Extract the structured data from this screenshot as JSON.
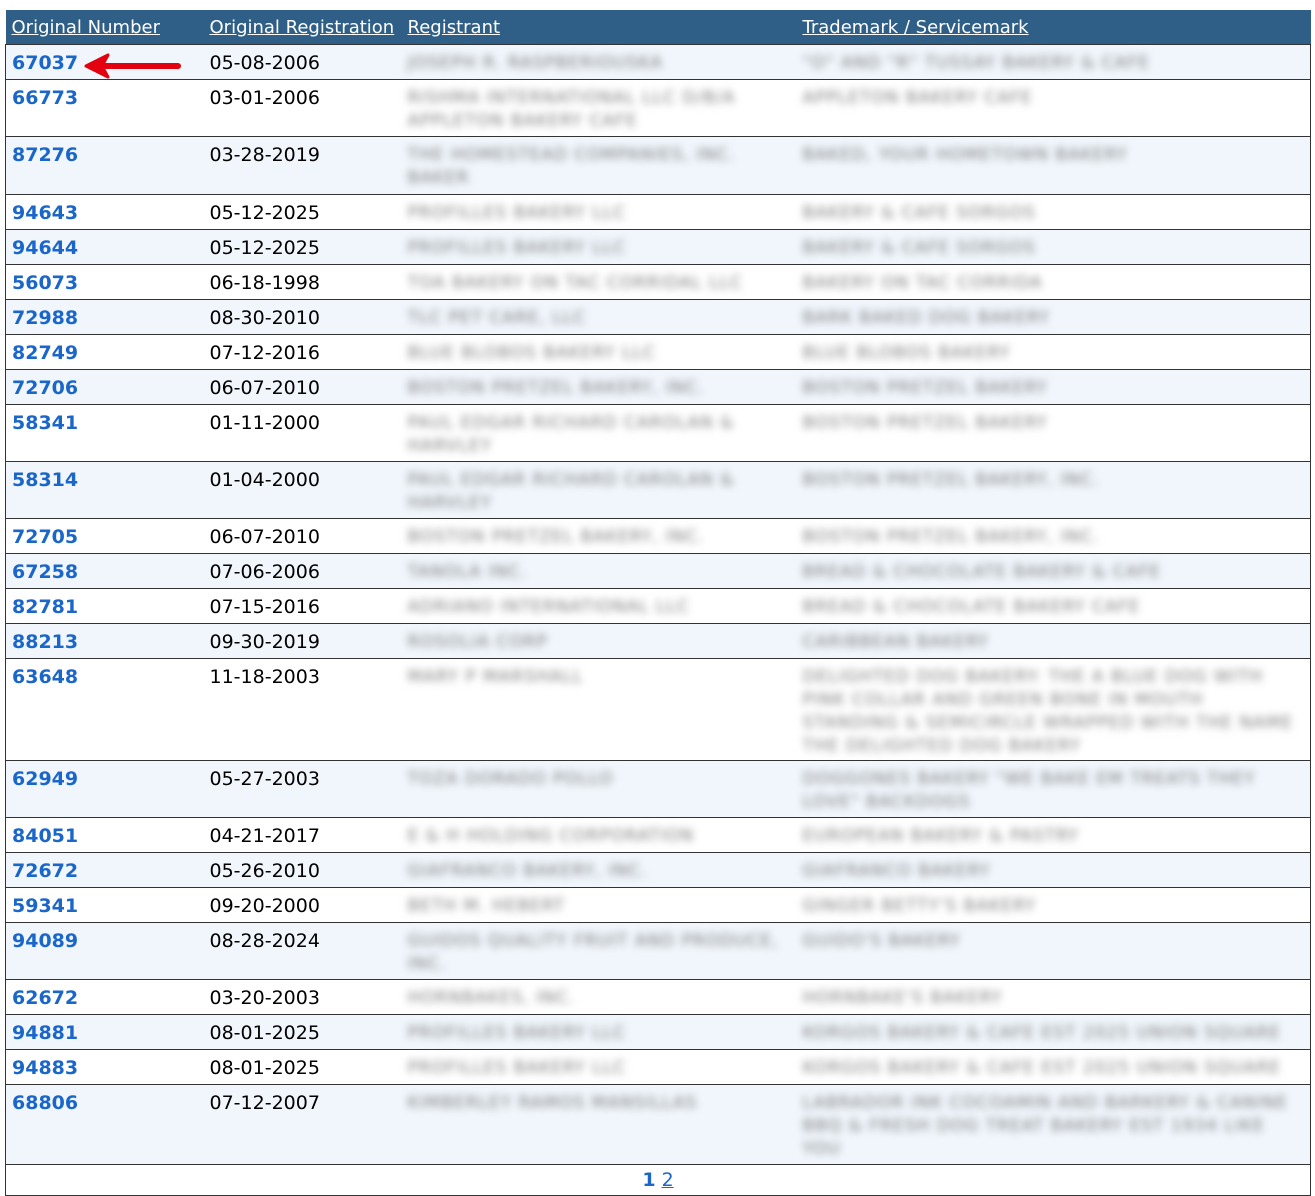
{
  "headers": [
    "Original Number",
    "Original Registration",
    "Registrant",
    "Trademark / Servicemark"
  ],
  "rows": [
    {
      "number": "67037",
      "date": "05-08-2006",
      "registrant": "JOSEPH R. RASPBERIOUSKA",
      "mark": "\"O\" AND \"R\" TUSSAY BAKERY & CAFE"
    },
    {
      "number": "66773",
      "date": "03-01-2006",
      "registrant": "RISHMA INTERNATIONAL LLC D/B/A APPLETON BAKERY CAFE",
      "mark": "APPLETON BAKERY CAFE"
    },
    {
      "number": "87276",
      "date": "03-28-2019",
      "registrant": "THE HOMESTEAD COMPANIES, INC. BAKER",
      "mark": "BAKED, YOUR HOMETOWN BAKERY"
    },
    {
      "number": "94643",
      "date": "05-12-2025",
      "registrant": "PROFILLES BAKERY LLC",
      "mark": "BAKERY & CAFE SORGOS"
    },
    {
      "number": "94644",
      "date": "05-12-2025",
      "registrant": "PROFILLES BAKERY LLC",
      "mark": "BAKERY & CAFE SORGOS"
    },
    {
      "number": "56073",
      "date": "06-18-1998",
      "registrant": "TOA BAKERY ON TAC CORRIDAL LLC",
      "mark": "BAKERY ON TAC CORRIDA"
    },
    {
      "number": "72988",
      "date": "08-30-2010",
      "registrant": "TLC PET CARE, LLC",
      "mark": "BARK BAKED DOG BAKERY"
    },
    {
      "number": "82749",
      "date": "07-12-2016",
      "registrant": "BLUE BLOBOS BAKERY LLC",
      "mark": "BLUE BLOBOS BAKERY"
    },
    {
      "number": "72706",
      "date": "06-07-2010",
      "registrant": "BOSTON PRETZEL BAKERY, INC.",
      "mark": "BOSTON PRETZEL BAKERY"
    },
    {
      "number": "58341",
      "date": "01-11-2000",
      "registrant": "PAUL EDGAR RICHARD CAROLAN & HARVLEY",
      "mark": "BOSTON PRETZEL BAKERY"
    },
    {
      "number": "58314",
      "date": "01-04-2000",
      "registrant": "PAUL EDGAR RICHARD CAROLAN & HARVLEY",
      "mark": "BOSTON PRETZEL BAKERY, INC."
    },
    {
      "number": "72705",
      "date": "06-07-2010",
      "registrant": "BOSTON PRETZEL BAKERY, INC.",
      "mark": "BOSTON PRETZEL BAKERY, INC."
    },
    {
      "number": "67258",
      "date": "07-06-2006",
      "registrant": "TANOLA INC.",
      "mark": "BREAD & CHOCOLATE BAKERY & CAFE"
    },
    {
      "number": "82781",
      "date": "07-15-2016",
      "registrant": "ADRIANO INTERNATIONAL LLC",
      "mark": "BREAD & CHOCOLATE BAKERY CAFE"
    },
    {
      "number": "88213",
      "date": "09-30-2019",
      "registrant": "ROSOLIA CORP",
      "mark": "CARIBBEAN BAKERY"
    },
    {
      "number": "63648",
      "date": "11-18-2003",
      "registrant": "MARY P MARSHALL",
      "mark": "DELIGHTED DOG BAKERY: THE A BLUE DOG WITH PINK COLLAR AND GREEN BONE IN MOUTH STANDING & SEMICIRCLE WRAPPED WITH THE NAME THE DELIGHTED DOG BAKERY"
    },
    {
      "number": "62949",
      "date": "05-27-2003",
      "registrant": "TOZA DORADO POLLO",
      "mark": "DOGGONES BAKERY \"WE BAKE EM TREATS THEY LOVE\" BACKDOGS"
    },
    {
      "number": "84051",
      "date": "04-21-2017",
      "registrant": "E & H HOLDING CORPORATION",
      "mark": "EUROPEAN BAKERY & PASTRY"
    },
    {
      "number": "72672",
      "date": "05-26-2010",
      "registrant": "GIAFRANCO BAKERY, INC.",
      "mark": "GIAFRANCO BAKERY"
    },
    {
      "number": "59341",
      "date": "09-20-2000",
      "registrant": "BETH M. HEBERT",
      "mark": "GINGER BETTY'S BAKERY"
    },
    {
      "number": "94089",
      "date": "08-28-2024",
      "registrant": "GUIDOS QUALITY FRUIT AND PRODUCE, INC.",
      "mark": "GUIDO'S BAKERY"
    },
    {
      "number": "62672",
      "date": "03-20-2003",
      "registrant": "HORNBAKES, INC.",
      "mark": "HORNBAKE'S BAKERY"
    },
    {
      "number": "94881",
      "date": "08-01-2025",
      "registrant": "PROFILLES BAKERY LLC",
      "mark": "KORGOS BAKERY & CAFE EST 2025 UNION SQUARE"
    },
    {
      "number": "94883",
      "date": "08-01-2025",
      "registrant": "PROFILLES BAKERY LLC",
      "mark": "KORGOS BAKERY & CAFE EST 2025 UNION SQUARE"
    },
    {
      "number": "68806",
      "date": "07-12-2007",
      "registrant": "KIMBERLEY RAMOS MANSILLAS",
      "mark": "LABRADOR INK COCOAMIN AND BARKERY & CANINE BBQ & FRESH DOG TREAT BAKERY EST 1934 LIKE YOU"
    }
  ],
  "pagination": {
    "current": "1",
    "next": "2"
  },
  "annotation": {
    "type": "arrow",
    "color": "#e3000f",
    "points_to": "67037"
  }
}
